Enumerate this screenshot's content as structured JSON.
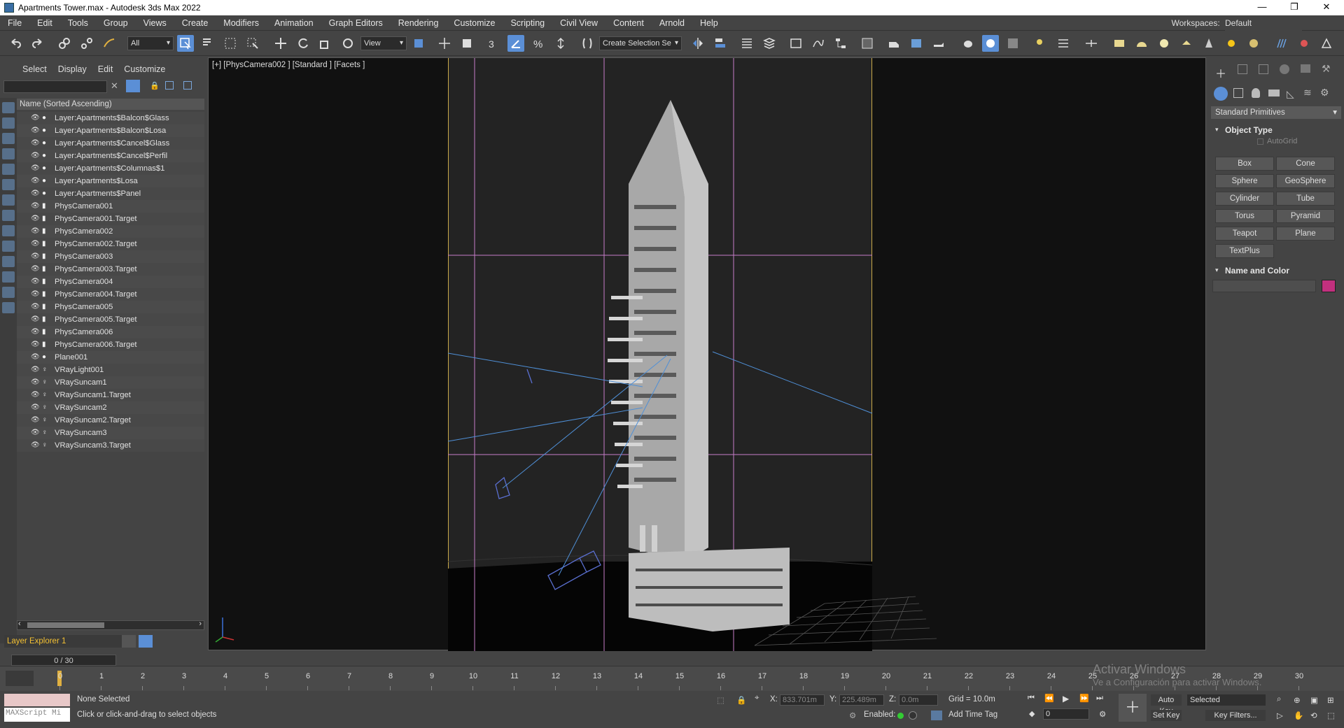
{
  "window": {
    "title": "Apartments Tower.max - Autodesk 3ds Max 2022"
  },
  "menu": [
    "File",
    "Edit",
    "Tools",
    "Group",
    "Views",
    "Create",
    "Modifiers",
    "Animation",
    "Graph Editors",
    "Rendering",
    "Customize",
    "Scripting",
    "Civil View",
    "Content",
    "Arnold",
    "Help"
  ],
  "workspace": {
    "label": "Workspaces:",
    "value": "Default"
  },
  "toolbar": {
    "filter_value": "All",
    "refcoord_value": "View",
    "selection_set_value": "Create Selection Se"
  },
  "explorer": {
    "tabs": [
      "Select",
      "Display",
      "Edit",
      "Customize"
    ],
    "column_header": "Name (Sorted Ascending)",
    "items": [
      {
        "label": "Layer:Apartments$Balcon$Glass",
        "type": "layer"
      },
      {
        "label": "Layer:Apartments$Balcon$Losa",
        "type": "layer"
      },
      {
        "label": "Layer:Apartments$Cancel$Glass",
        "type": "layer"
      },
      {
        "label": "Layer:Apartments$Cancel$Perfil",
        "type": "layer"
      },
      {
        "label": "Layer:Apartments$Columnas$1",
        "type": "layer"
      },
      {
        "label": "Layer:Apartments$Losa",
        "type": "layer"
      },
      {
        "label": "Layer:Apartments$Panel",
        "type": "layer"
      },
      {
        "label": "PhysCamera001",
        "type": "camera"
      },
      {
        "label": "PhysCamera001.Target",
        "type": "camera"
      },
      {
        "label": "PhysCamera002",
        "type": "camera"
      },
      {
        "label": "PhysCamera002.Target",
        "type": "camera"
      },
      {
        "label": "PhysCamera003",
        "type": "camera"
      },
      {
        "label": "PhysCamera003.Target",
        "type": "camera"
      },
      {
        "label": "PhysCamera004",
        "type": "camera"
      },
      {
        "label": "PhysCamera004.Target",
        "type": "camera"
      },
      {
        "label": "PhysCamera005",
        "type": "camera"
      },
      {
        "label": "PhysCamera005.Target",
        "type": "camera"
      },
      {
        "label": "PhysCamera006",
        "type": "camera"
      },
      {
        "label": "PhysCamera006.Target",
        "type": "camera"
      },
      {
        "label": "Plane001",
        "type": "layer"
      },
      {
        "label": "VRayLight001",
        "type": "light"
      },
      {
        "label": "VRaySuncam1",
        "type": "light"
      },
      {
        "label": "VRaySuncam1.Target",
        "type": "light"
      },
      {
        "label": "VRaySuncam2",
        "type": "light"
      },
      {
        "label": "VRaySuncam2.Target",
        "type": "light"
      },
      {
        "label": "VRaySuncam3",
        "type": "light"
      },
      {
        "label": "VRaySuncam3.Target",
        "type": "light"
      }
    ],
    "layer_explorer": "Layer Explorer 1",
    "frames": "0 / 30"
  },
  "viewport": {
    "label": "[+] [PhysCamera002 ] [Standard ] [Facets ]"
  },
  "command_panel": {
    "category": "Standard Primitives",
    "object_type_title": "Object Type",
    "autogrid": "AutoGrid",
    "buttons": [
      "Box",
      "Cone",
      "Sphere",
      "GeoSphere",
      "Cylinder",
      "Tube",
      "Torus",
      "Pyramid",
      "Teapot",
      "Plane",
      "TextPlus"
    ],
    "name_color_title": "Name and Color",
    "swatch_color": "#c2307e"
  },
  "timeline": {
    "ticks": [
      "0",
      "1",
      "2",
      "3",
      "4",
      "5",
      "6",
      "7",
      "8",
      "9",
      "10",
      "11",
      "12",
      "13",
      "14",
      "15",
      "16",
      "17",
      "18",
      "19",
      "20",
      "21",
      "22",
      "23",
      "24",
      "25",
      "26",
      "27",
      "28",
      "29",
      "30"
    ]
  },
  "status": {
    "maxscript": "MAXScript Mi",
    "selection": "None Selected",
    "prompt": "Click or click-and-drag to select objects",
    "x_label": "X:",
    "x_value": "833.701m",
    "y_label": "Y:",
    "y_value": "225.489m",
    "z_label": "Z:",
    "z_value": "0.0m",
    "grid": "Grid = 10.0m",
    "enabled": "Enabled:",
    "add_time_tag": "Add Time Tag",
    "auto_key": "Auto Key",
    "selected": "Selected",
    "set_key": "Set Key",
    "key_filters": "Key Filters...",
    "frame_value": "0"
  },
  "watermark": {
    "line1": "Activar Windows",
    "line2": "Ve a Configuración para activar Windows."
  }
}
